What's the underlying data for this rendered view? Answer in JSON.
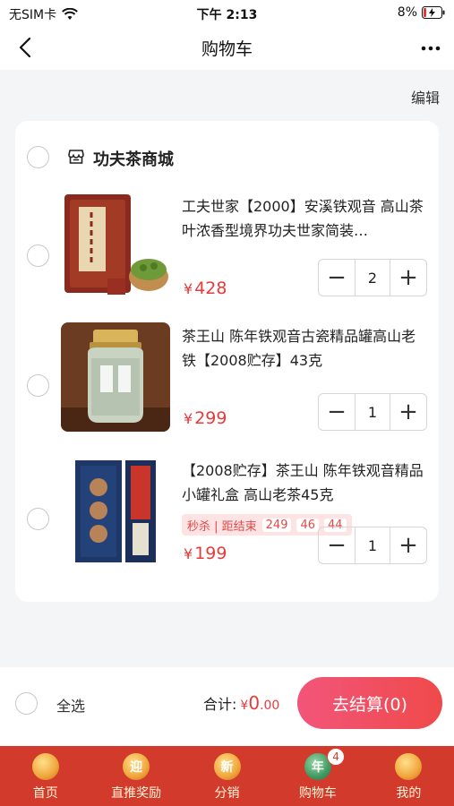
{
  "status_bar": {
    "carrier": "无SIM卡",
    "time": "下午 2:13",
    "battery": "8%"
  },
  "nav": {
    "title": "购物车",
    "back_icon": "chevron-left-icon",
    "more_icon": "more-horizontal-icon"
  },
  "edit_label": "编辑",
  "shop": {
    "name": "功夫茶商城",
    "icon": "store-icon"
  },
  "products": [
    {
      "title": "工夫世家【2000】安溪铁观音 高山茶叶浓香型境界功夫世家简装…",
      "price_symbol": "¥",
      "price": "428",
      "quantity": "2"
    },
    {
      "title": "茶王山 陈年铁观音古瓷精品罐高山老铁【2008贮存】43克",
      "price_symbol": "¥",
      "price": "299",
      "quantity": "1"
    },
    {
      "title": "【2008贮存】茶王山 陈年铁观音精品小罐礼盒 高山老茶45克",
      "price_symbol": "¥",
      "price": "199",
      "quantity": "1",
      "flash_sale": {
        "label": "秒杀 | 距结束",
        "hours": "249",
        "minutes": "46",
        "seconds": "44"
      }
    }
  ],
  "checkout": {
    "select_all_label": "全选",
    "total_label": "合计:",
    "total_symbol": "¥",
    "total_int": "0",
    "total_dec": ".00",
    "button_label": "去结算(0)"
  },
  "tabs": [
    {
      "label": "首页",
      "icon_text": ""
    },
    {
      "label": "直推奖励",
      "icon_text": "迎"
    },
    {
      "label": "分销",
      "icon_text": "新"
    },
    {
      "label": "购物车",
      "icon_text": "年",
      "badge": "4"
    },
    {
      "label": "我的",
      "icon_text": ""
    }
  ],
  "colors": {
    "accent": "#e83a3a",
    "tab_bar": "#d23b2c",
    "checkout_gradient_start": "#f2557a",
    "checkout_gradient_end": "#ef4a4a"
  }
}
